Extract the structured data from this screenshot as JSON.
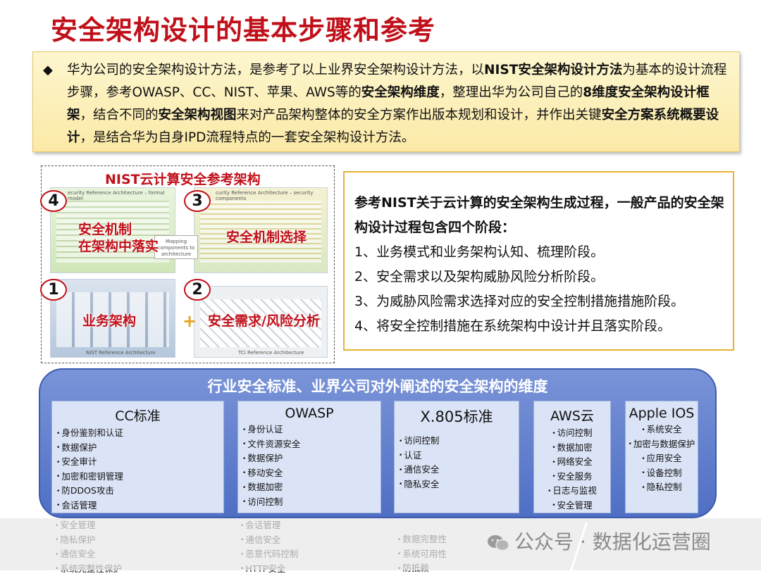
{
  "page_title": "安全架构设计的基本步骤和参考",
  "intro": {
    "bullet": "◆",
    "segments": [
      {
        "t": "华为公司的安全架构设计方法，是参考了以上业界安全架构设计方法，以",
        "b": false
      },
      {
        "t": "NIST安全架构设计方法",
        "b": true
      },
      {
        "t": "为基本的设计流程步骤，参考OWASP、CC、NIST、苹果、AWS等的",
        "b": false
      },
      {
        "t": "安全架构维度",
        "b": true
      },
      {
        "t": "，整理出华为公司自己的",
        "b": false
      },
      {
        "t": "8维度安全架构设计框架",
        "b": true
      },
      {
        "t": "，结合不同的",
        "b": false
      },
      {
        "t": "安全架构视图",
        "b": true
      },
      {
        "t": "来对产品架构整体的安全方案作出版本规划和设计，并作出关键",
        "b": false
      },
      {
        "t": "安全方案系统概要设计",
        "b": true
      },
      {
        "t": "，是结合华为自身IPD流程特点的一套安全架构设计方法。",
        "b": false
      }
    ]
  },
  "diagram": {
    "title": "NIST云计算安全参考架构",
    "steps": [
      {
        "num": "4",
        "label": "安全机制\n在架构中落实"
      },
      {
        "num": "3",
        "label": "安全机制选择"
      },
      {
        "num": "1",
        "label": "业务架构"
      },
      {
        "num": "2",
        "label": "安全需求/风险分析"
      }
    ],
    "plus": "+",
    "small_caps": {
      "p4_top": "ecurity Reference Architecture – formal model",
      "p3_top": "curity Reference Architecture – security components",
      "p1_bottom": "NIST Reference Architecture",
      "p2_bottom": "TCI Reference Architecture",
      "mapping": "Mapping components to architecture"
    }
  },
  "phases": {
    "head": "参考NIST关于云计算的安全架构生成过程，一般产品的安全架构设计过程包含四个阶段：",
    "items": [
      "1、业务模式和业务架构认知、梳理阶段。",
      "2、安全需求以及架构威胁风险分析阶段。",
      "3、为威胁风险需求选择对应的安全控制措施措施阶段。",
      "4、将安全控制措施在系统架构中设计并且落实阶段。"
    ]
  },
  "dimensions": {
    "title": "行业安全标准、业界公司对外阐述的安全架构的维度",
    "cards": [
      {
        "title": "CC标准",
        "items": [
          "身份鉴别和认证",
          "数据保护",
          "安全审计",
          "加密和密钥管理",
          "防DDOS攻击",
          "会话管理"
        ],
        "overflow": [
          "安全管理",
          "隐私保护",
          "通信安全",
          "系统完整性保护"
        ]
      },
      {
        "title": "OWASP",
        "items": [
          "身份认证",
          "文件资源安全",
          "数据保护",
          "移动安全",
          "数据加密",
          "访问控制"
        ],
        "overflow": [
          "会话管理",
          "通信安全",
          "恶意代码控制",
          "HTTP安全"
        ]
      },
      {
        "title": "X.805标准",
        "items": [
          "访问控制",
          "认证",
          "通信安全",
          "隐私安全"
        ],
        "overflow": [
          "数据完整性",
          "系统可用性",
          "防抵赖"
        ]
      },
      {
        "title": "AWS云",
        "items": [
          "访问控制",
          "数据加密",
          "网络安全",
          "安全服务",
          "日志与监视",
          "安全管理"
        ],
        "overflow": []
      },
      {
        "title": "Apple IOS",
        "items": [
          "系统安全",
          "加密与数据保护",
          "应用安全",
          "设备控制",
          "隐私控制"
        ],
        "overflow": []
      }
    ]
  },
  "watermark": {
    "text": "公众号 · 数据化运营圈",
    "icon": "wechat-icon"
  }
}
